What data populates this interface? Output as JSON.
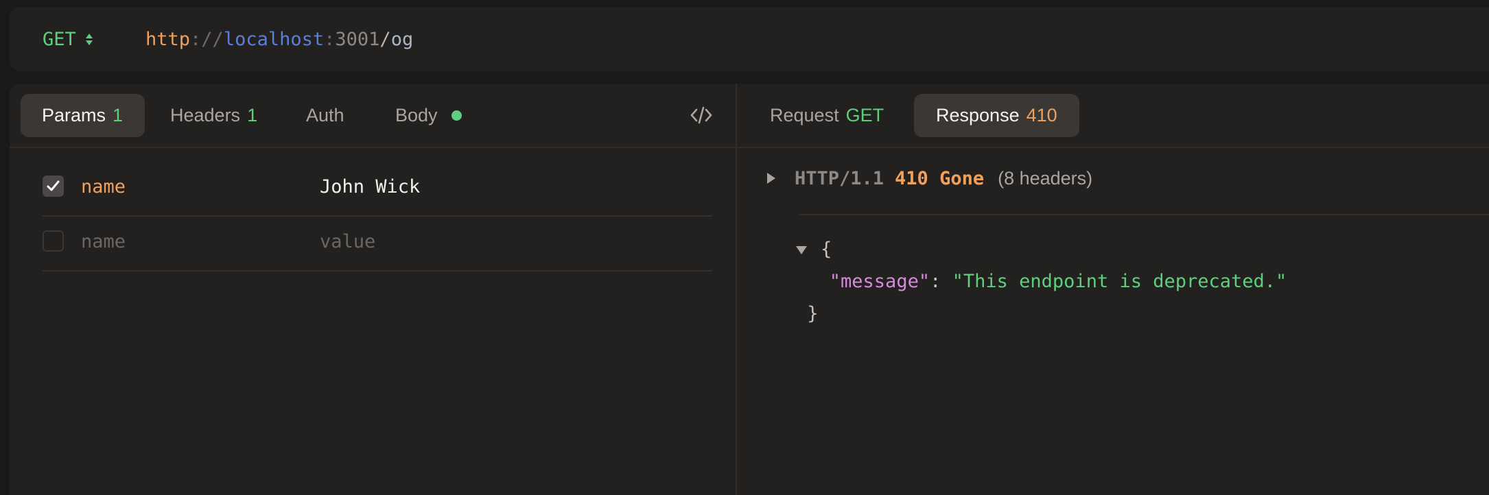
{
  "request": {
    "method": "GET",
    "url": {
      "scheme": "http",
      "separator": "://",
      "host": "localhost",
      "colon": ":",
      "port": "3001",
      "slash": "/",
      "path": "og"
    }
  },
  "request_tabs": [
    {
      "label": "Params",
      "count": "1",
      "active": true
    },
    {
      "label": "Headers",
      "count": "1",
      "active": false
    },
    {
      "label": "Auth",
      "count": "",
      "active": false
    },
    {
      "label": "Body",
      "indicator": "green-dot",
      "active": false
    }
  ],
  "params": [
    {
      "enabled": true,
      "key": "name",
      "value": "John Wick"
    }
  ],
  "new_param": {
    "key_placeholder": "name",
    "value_placeholder": "value"
  },
  "response_tabs": [
    {
      "label": "Request",
      "badge": "GET",
      "active": false
    },
    {
      "label": "Response",
      "badge": "410",
      "active": true
    }
  ],
  "response": {
    "http_version": "HTTP/1.1",
    "status": "410 Gone",
    "headers_count": "(8 headers)",
    "body": {
      "open_brace": "{",
      "key": "\"message\"",
      "colon": ":",
      "value": "\"This endpoint is deprecated.\"",
      "close_brace": "}"
    }
  },
  "colors": {
    "green": "#5fcf7d",
    "orange": "#f0a05a",
    "blue": "#5b7fd8",
    "pink": "#d689dd",
    "background": "#1a1818",
    "panel": "#232120"
  }
}
